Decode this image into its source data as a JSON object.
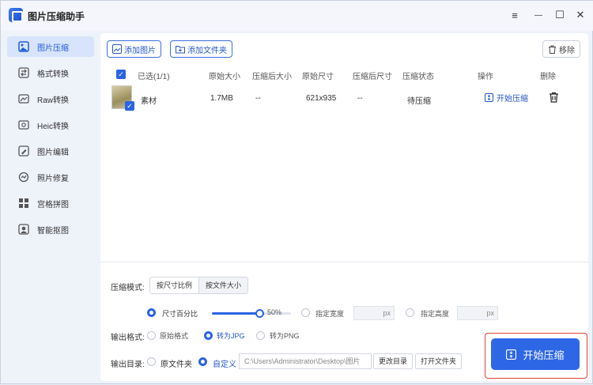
{
  "app": {
    "title": "图片压缩助手"
  },
  "window_controls": {
    "menu": "≡",
    "minimize": "—",
    "maximize": "☐",
    "close": "✕"
  },
  "sidebar": {
    "items": [
      {
        "label": "图片压缩",
        "icon": "image-compress-icon",
        "active": true
      },
      {
        "label": "格式转换",
        "icon": "format-convert-icon"
      },
      {
        "label": "Raw转换",
        "icon": "raw-icon"
      },
      {
        "label": "Heic转换",
        "icon": "heic-icon"
      },
      {
        "label": "图片编辑",
        "icon": "edit-icon"
      },
      {
        "label": "照片修复",
        "icon": "repair-icon"
      },
      {
        "label": "宫格拼图",
        "icon": "grid-icon"
      },
      {
        "label": "智能抠图",
        "icon": "cutout-icon"
      }
    ]
  },
  "toolbar": {
    "add_image": "添加图片",
    "add_folder": "添加文件夹",
    "remove": "移除"
  },
  "table": {
    "headers": [
      "已选(1/1)",
      "原始大小",
      "压缩后大小",
      "原始尺寸",
      "压缩后尺寸",
      "压缩状态",
      "操作",
      "删除"
    ],
    "rows": [
      {
        "name": "素材",
        "orig_size": "1.7MB",
        "comp_size": "--",
        "orig_dim": "621x935",
        "comp_dim": "--",
        "status": "待压缩",
        "action": "开始压缩"
      }
    ]
  },
  "options": {
    "mode_label": "压缩模式:",
    "mode_tabs": [
      "按尺寸比例",
      "按文件大小"
    ],
    "size_percent": "尺寸百分比",
    "percent_value": "50%",
    "percent_fraction": 0.5,
    "width_label": "指定宽度",
    "height_label": "指定高度",
    "px": "px",
    "format_label": "输出格式:",
    "formats": [
      "原始格式",
      "转为JPG",
      "转为PNG"
    ],
    "output_label": "输出目录:",
    "dir_original": "原文件夹",
    "dir_custom": "自定义",
    "path": "C:\\Users\\Administrator\\Desktop\\图片",
    "change_dir": "更改目录",
    "open_folder": "打开文件夹"
  },
  "start_button": "开始压缩",
  "colors": {
    "accent": "#2e67e6",
    "highlight": "#e0403a"
  }
}
